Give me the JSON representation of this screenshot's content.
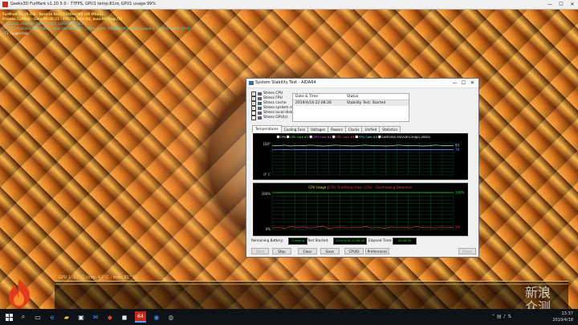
{
  "app": {
    "title": "Geeks3D FurMark v1.20.5.0 - 77FPS, GPU1 temp:81㎝, GPU1 usage:99%",
    "window_controls": [
      "—",
      "☐",
      "✕"
    ]
  },
  "osd": {
    "lines": [
      {
        "text": "FurMark v1.20.5.0 - Burn-in test, 1920x1080 (0X MSAA)",
        "color": "#e8e05a"
      },
      {
        "text": "Frames:129860 - time:00:28:21 - FPS:76 (min:64, max:99, avg:75)",
        "color": "#e8e05a"
      },
      {
        "text": "> OpenGL renderer: GeForce GTX 1660/PCIe/SSE2",
        "color": "#4fd3d8"
      },
      {
        "text": "> GPU 1 (GeForce GTX 1660) - core: 1845MHz/81° C/99%, mem: 3999MHz/9%, limits:[power:1, temp:0, volt:0, OV:0]",
        "color": "#4fd3d8"
      },
      {
        "text": "- F1: toggle help",
        "color": "#e6e6e6"
      }
    ],
    "gpu_graph_label": "GPU 1: 81° C (min: 42° C - max: 81° C)"
  },
  "watermark": "新浪\n众测",
  "taskbar": {
    "apps": [
      "start-icon",
      "search-icon",
      "taskview-icon",
      "edge-icon",
      "explorer-icon",
      "store-icon",
      "mail-icon",
      "app-red-icon",
      "app-dark-icon",
      "furmark-icon",
      "aida-icon",
      "app-gray-icon"
    ],
    "active_label": "64",
    "clock_time": "23:37",
    "clock_date": "2019/4/18"
  },
  "aida": {
    "title": "System Stability Test - AIDA64",
    "window_controls": [
      "—",
      "☐",
      "✕"
    ],
    "stress_items": [
      {
        "label": "Stress CPU",
        "checked": true
      },
      {
        "label": "Stress FPU",
        "checked": true
      },
      {
        "label": "Stress cache",
        "checked": true
      },
      {
        "label": "Stress system memory",
        "checked": true
      },
      {
        "label": "Stress local disks",
        "checked": false
      },
      {
        "label": "Stress GPU(s)",
        "checked": false
      }
    ],
    "status_table": {
      "headers": [
        "Date & Time",
        "Status"
      ],
      "rows": [
        [
          "2019/4/18 22:08:28",
          "Stability Test: Started"
        ]
      ]
    },
    "tabs": [
      "Temperatures",
      "Cooling Fans",
      "Voltages",
      "Powers",
      "Clocks",
      "Unified",
      "Statistics"
    ],
    "active_tab": "Temperatures",
    "temp_chart_legend": [
      "CPU",
      "CPU Core #1",
      "CPU Core #2",
      "CPU Core #3",
      "CPU Core #4",
      "SAMSUNG MZVLB512HAJQ-000H1"
    ],
    "usage_chart_title": "CPU Usage",
    "usage_chart_title_sep": "|",
    "usage_chart_subtitle": "CPU Throttling (max: 11%) - Overheating Detected!",
    "footer": {
      "battery_label": "Remaining Battery:",
      "battery_value": "Charging",
      "test_started_label": "Test Started:",
      "test_started_value": "2019/4/18 22:08:28",
      "elapsed_label": "Elapsed Time:",
      "elapsed_value": "00:28:59"
    },
    "buttons": {
      "start": "Start",
      "stop": "Stop",
      "clear": "Clear",
      "save": "Save",
      "cpuid": "CPUID",
      "preferences": "Preferences",
      "close": "Close"
    },
    "colors": {
      "grid": "#0f5c2a",
      "trace_temp": "#d8d8d8",
      "trace_usage": "#1ee01e",
      "trace_throttle": "#d43c3c",
      "title_usage": "#e6e65a",
      "title_throttle": "#e04040"
    }
  },
  "chart_data": [
    {
      "type": "line",
      "title": "",
      "ylim": [
        0,
        100
      ],
      "y_ticks": [
        "100°",
        "0° C"
      ],
      "series": [
        {
          "name": "CPU",
          "values": [
            92,
            91,
            93,
            90,
            92,
            91,
            93,
            92,
            90,
            91,
            93,
            92,
            91,
            90,
            92,
            93,
            91,
            92,
            90,
            91,
            93,
            92,
            91,
            92,
            90,
            91,
            93,
            92,
            91,
            92
          ]
        },
        {
          "name": "SAMSUNG MZVLB512HAJQ-000H1",
          "values": [
            78,
            78,
            79,
            78,
            79,
            79,
            79,
            79,
            79,
            79,
            79,
            79,
            79,
            79,
            79,
            79,
            79,
            79,
            79,
            79,
            79,
            79,
            79,
            79,
            79,
            79,
            79,
            79,
            79,
            79
          ]
        }
      ],
      "value_labels": [
        "93",
        "79"
      ]
    },
    {
      "type": "line",
      "title": "CPU Usage | CPU Throttling (max: 11%) - Overheating Detected!",
      "ylim": [
        0,
        100
      ],
      "y_ticks": [
        "100%",
        "0%"
      ],
      "series": [
        {
          "name": "CPU Usage",
          "values": [
            100,
            100,
            100,
            100,
            100,
            100,
            100,
            100,
            100,
            100,
            100,
            100,
            100,
            100,
            100,
            100,
            100,
            100,
            100,
            100,
            100,
            100,
            100,
            100,
            100,
            100,
            100,
            100,
            100,
            100
          ]
        },
        {
          "name": "CPU Throttling",
          "values": [
            4,
            6,
            3,
            8,
            5,
            7,
            4,
            6,
            9,
            3,
            5,
            7,
            4,
            6,
            5,
            8,
            4,
            6,
            3,
            7,
            5,
            6,
            4,
            8,
            5,
            6,
            4,
            7,
            5,
            6
          ]
        }
      ],
      "value_labels": [
        "100%",
        "5%"
      ]
    }
  ]
}
